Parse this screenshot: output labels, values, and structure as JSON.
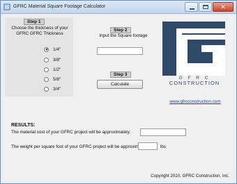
{
  "window": {
    "title": "GFRC Material Square Footage Calculator"
  },
  "step1": {
    "label": "Step 1",
    "description": "Choose the thickness of your GFRC GFRC Thickness",
    "options": [
      {
        "label": "1/4\"",
        "selected": true
      },
      {
        "label": "3/8\"",
        "selected": false
      },
      {
        "label": "1/2\"",
        "selected": false
      },
      {
        "label": "5/8\"",
        "selected": false
      },
      {
        "label": "3/4\"",
        "selected": false
      }
    ]
  },
  "step2": {
    "label": "Step 2",
    "description": "Input the Square footage",
    "value": ""
  },
  "step3": {
    "label": "Step 3",
    "button_label": "Calculate"
  },
  "logo": {
    "letters": "G F R C",
    "wordmark": "CONSTRUCTION",
    "link": "www.gfrcconstruction.com",
    "color": "#2f4a68"
  },
  "results": {
    "title": "RESULTS:",
    "cost_label": "The material cost of your GFRC project will be approximately:",
    "cost_value": "",
    "weight_label": "The weight per square foot of your GFRC project will be approximately:",
    "weight_value": "",
    "weight_unit": "lbs"
  },
  "footer": {
    "copyright": "Copyright 2010, GFRC Construction, Inc."
  }
}
